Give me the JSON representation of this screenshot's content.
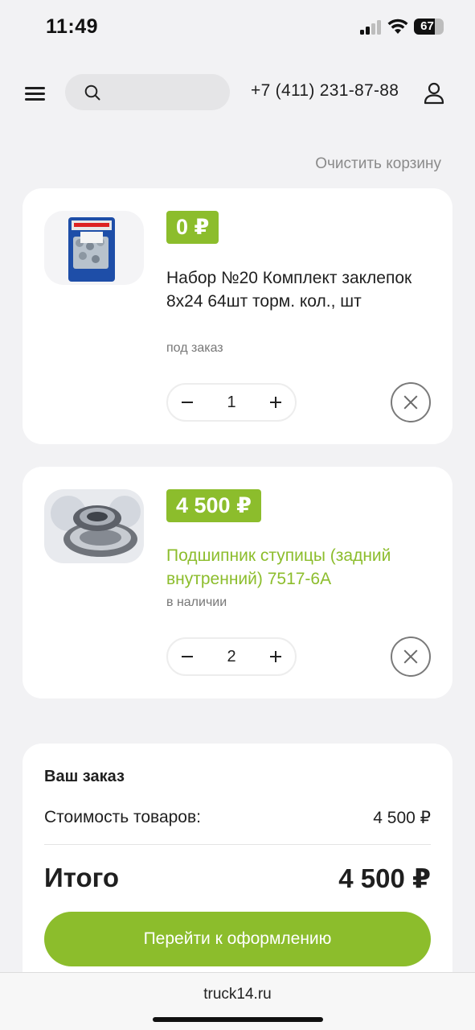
{
  "status_bar": {
    "time": "11:49",
    "battery": "67"
  },
  "header": {
    "search_placeholder": "",
    "phone": "+7 (411) 231-87-88"
  },
  "cart": {
    "clear_label": "Очистить корзину",
    "items": [
      {
        "price": "0 ₽",
        "title": "Набор №20 Комплект заклепок 8х24 64шт торм. кол., шт",
        "availability": "под заказ",
        "quantity": "1"
      },
      {
        "price": "4 500 ₽",
        "title": "Подшипник ступицы (задний внутренний) 7517-6А",
        "availability": "в наличии",
        "quantity": "2"
      }
    ]
  },
  "order": {
    "title": "Ваш заказ",
    "goods_cost_label": "Стоимость товаров:",
    "goods_cost_value": "4 500 ₽",
    "total_label": "Итого",
    "total_value": "4 500 ₽",
    "checkout_label": "Перейти к оформлению"
  },
  "browser": {
    "url": "truck14.ru"
  },
  "colors": {
    "accent": "#8cbd2c",
    "background": "#f2f2f4"
  }
}
